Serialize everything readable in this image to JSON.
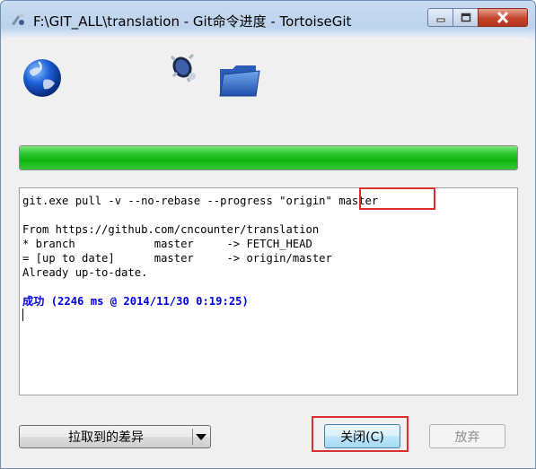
{
  "window": {
    "title": "F:\\GIT_ALL\\translation - Git命令进度 - TortoiseGit"
  },
  "progress": {
    "value": 1.0
  },
  "log": {
    "command_prefix": "git.exe pull -v --no-rebase --progress \"origin\" ",
    "command_branch": "master",
    "lines": [
      "From https://github.com/cncounter/translation",
      "* branch            master     -> FETCH_HEAD",
      "= [up to date]      master     -> origin/master",
      "Already up-to-date."
    ],
    "success_label": "成功",
    "success_detail": " (2246 ms @ 2014/11/30 0:19:25)"
  },
  "buttons": {
    "diff_label": "拉取到的差异",
    "close_label": "关闭(C)",
    "discard_label": "放弃"
  },
  "colors": {
    "progress": "#1cb81c",
    "success_text": "#0000e0",
    "highlight_box": "#d83030"
  },
  "icons": [
    "globe-icon",
    "tortoise-icon",
    "folder-icon",
    "minimize-icon",
    "maximize-icon",
    "close-icon"
  ]
}
